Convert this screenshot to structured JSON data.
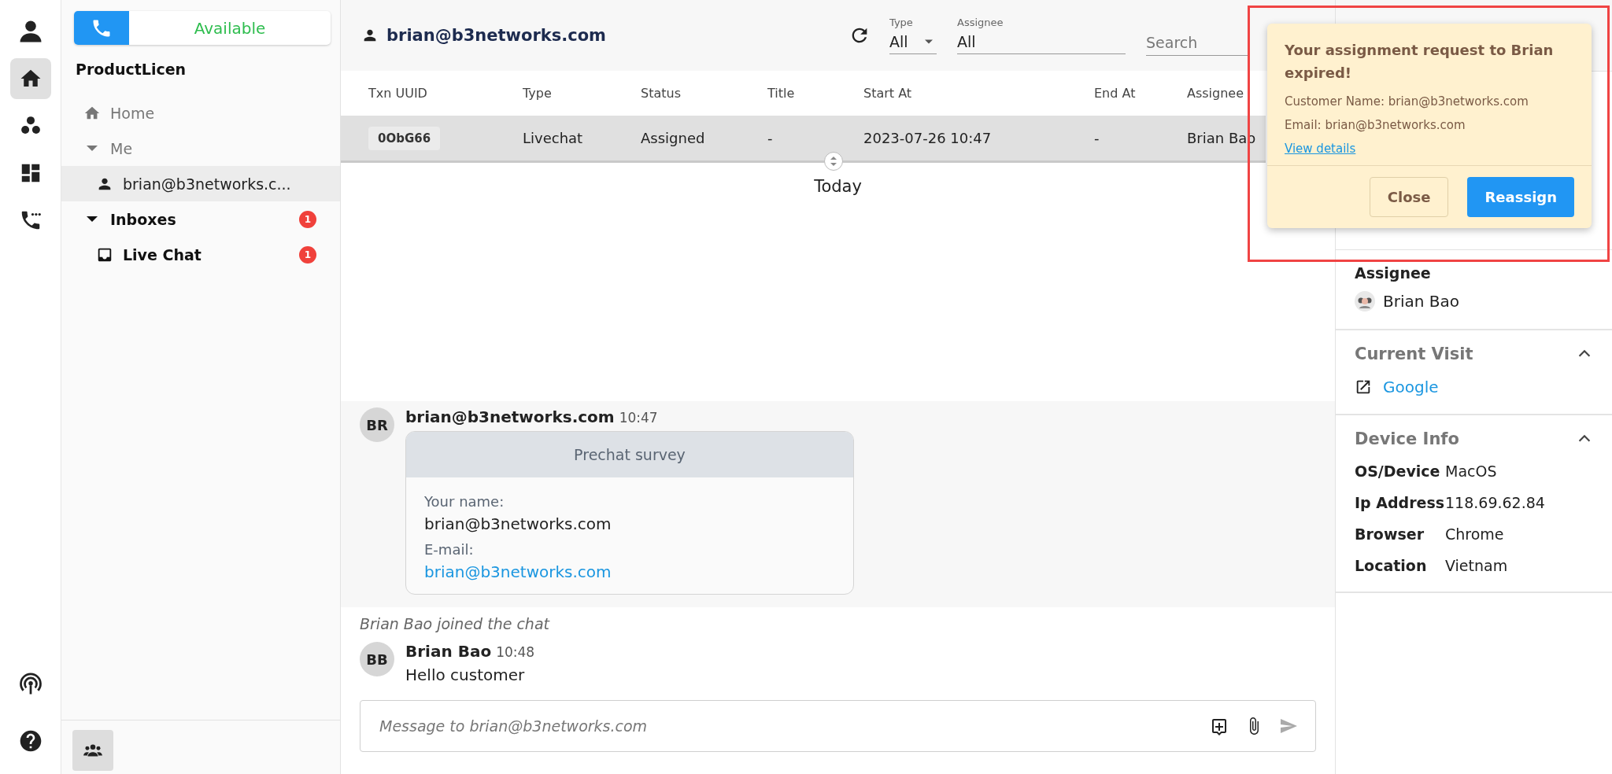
{
  "rail": [
    {
      "kind": "account",
      "selected": false
    },
    {
      "kind": "home",
      "selected": true
    },
    {
      "kind": "team",
      "selected": false
    },
    {
      "kind": "dashboard",
      "selected": false
    },
    {
      "kind": "calls",
      "selected": false
    }
  ],
  "rail_bottom": [
    {
      "kind": "broadcast",
      "selected": false
    },
    {
      "kind": "help",
      "selected": false
    }
  ],
  "status_button": {
    "label": "Available"
  },
  "org": "ProductLicen",
  "nav": [
    {
      "kind": "home",
      "label": "Home",
      "selected": false
    },
    {
      "kind": "folder",
      "label": "Me",
      "selected": false,
      "expanded": true,
      "children": [
        {
          "kind": "user",
          "label": "brian@b3networks.c...",
          "selected": true
        }
      ]
    },
    {
      "kind": "section",
      "label": "Inboxes",
      "selected": false,
      "expanded": true,
      "badge": "1",
      "children": [
        {
          "kind": "inbox",
          "label": "Live Chat",
          "badge": "1",
          "selected": false
        }
      ]
    }
  ],
  "header": {
    "title": "brian@b3networks.com",
    "type_filter": {
      "label": "Type",
      "value": "All"
    },
    "assignee_filter": {
      "label": "Assignee",
      "value": "All"
    },
    "search": {
      "placeholder": "Search"
    }
  },
  "table": {
    "columns": [
      "Txn UUID",
      "Type",
      "Status",
      "Title",
      "Start At",
      "End At",
      "Assignee"
    ],
    "rows": [
      {
        "selected": true,
        "cells": [
          "0ObG66",
          "Livechat",
          "Assigned",
          "-",
          "2023-07-26 10:47",
          "-",
          "Brian Bao"
        ]
      }
    ]
  },
  "date_divider": "Today",
  "messages": [
    {
      "kind": "survey",
      "initials": "BR",
      "sender": "brian@b3networks.com",
      "time": "10:47",
      "survey": {
        "title": "Prechat survey",
        "fields": [
          {
            "label": "Your name:",
            "value": "brian@b3networks.com",
            "link": false
          },
          {
            "label": "E-mail:",
            "value": "brian@b3networks.com",
            "link": true
          }
        ]
      }
    },
    {
      "kind": "event",
      "text": "Brian Bao joined the chat"
    },
    {
      "kind": "text",
      "initials": "BB",
      "sender": "Brian Bao",
      "time": "10:48",
      "text": "Hello customer"
    }
  ],
  "composer": {
    "placeholder": "Message to brian@b3networks.com"
  },
  "details": {
    "assignee": {
      "label": "Assignee",
      "name": "Brian Bao"
    },
    "sections": [
      {
        "kind": "links",
        "title": "Current Visit",
        "expanded": true,
        "links": [
          "Google"
        ]
      },
      {
        "kind": "props",
        "title": "Device Info",
        "expanded": true,
        "rows": [
          {
            "key": "OS/Device",
            "value": "MacOS"
          },
          {
            "key": "Ip Address",
            "value": "118.69.62.84"
          },
          {
            "key": "Browser",
            "value": "Chrome"
          },
          {
            "key": "Location",
            "value": "Vietnam"
          }
        ]
      }
    ]
  },
  "notification": {
    "title": "Your assignment request to Brian expired!",
    "lines": [
      "Customer Name: brian@b3networks.com",
      "Email: brian@b3networks.com"
    ],
    "link": "View details",
    "buttons": [
      {
        "kind": "secondary",
        "label": "Close"
      },
      {
        "kind": "primary",
        "label": "Reassign"
      }
    ]
  }
}
